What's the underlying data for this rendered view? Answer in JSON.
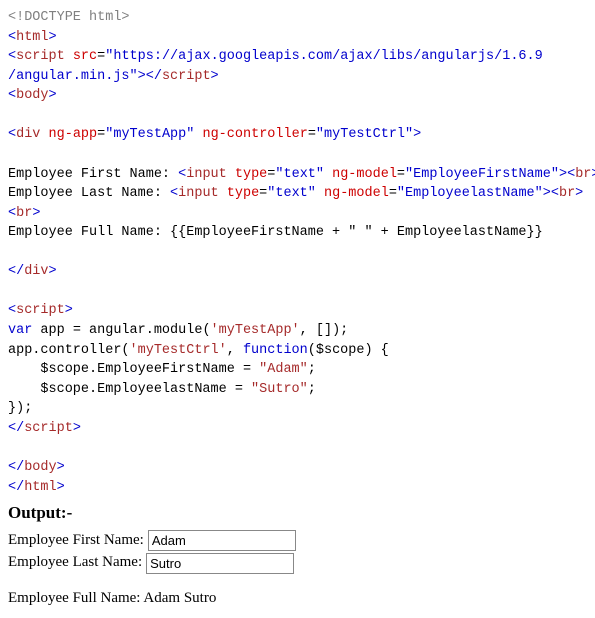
{
  "code": {
    "doctype": "<!DOCTYPE html>",
    "html_open_lt": "<",
    "html_open_name": "html",
    "html_open_gt": ">",
    "script_open_lt": "<",
    "script_name": "script",
    "src_attr": "src",
    "eq": "=",
    "src_val_q": "\"https://ajax.googleapis.com/ajax/libs/angularjs/1.6.9",
    "src_val2_q": "/angular.min.js\"",
    "script_open_gt": ">",
    "script_close": "</",
    "script_close_gt": ">",
    "body_open_lt": "<",
    "body_name": "body",
    "body_open_gt": ">",
    "div_open_lt": "<",
    "div_name": "div",
    "ngapp_attr": "ng-app",
    "ngapp_val": "\"myTestApp\"",
    "ngctrl_attr": "ng-controller",
    "ngctrl_val": "\"myTestCtrl\"",
    "div_open_gt": ">",
    "efn_label": "Employee First Name: ",
    "input_lt": "<",
    "input_name": "input",
    "type_attr": "type",
    "type_val": "\"text\"",
    "ngmodel_attr": "ng-model",
    "ngmodel_val1": "\"EmployeeFirstName\"",
    "input_gt": ">",
    "br_lt": "<",
    "br_name": "br",
    "br_gt": ">",
    "eln_label": "Employee Last Name: ",
    "ngmodel_val2": "\"EmployeelastName\"",
    "efull_line": "Employee Full Name: {{EmployeeFirstName + \" \" + EmployeelastName}}",
    "div_close_lt": "</",
    "div_close_gt": ">",
    "script2_open_lt": "<",
    "script2_open_gt": ">",
    "js_var": "var",
    "js_line1_rest": " app = angular.module(",
    "js_str1": "'myTestApp'",
    "js_line1_end": ", []);",
    "js_line2_a": "app.controller(",
    "js_str2": "'myTestCtrl'",
    "js_line2_b": ", ",
    "js_func": "function",
    "js_line2_c": "($scope) {",
    "js_line3_a": "    $scope.EmployeeFirstName = ",
    "js_str3": "\"Adam\"",
    "js_semi": ";",
    "js_line4_a": "    $scope.EmployeelastName = ",
    "js_str4": "\"Sutro\"",
    "js_line5": "});",
    "script2_close_lt": "</",
    "script2_close_gt": ">",
    "body_close_lt": "</",
    "body_close_gt": ">",
    "html_close_lt": "</",
    "html_close_gt": ">"
  },
  "output": {
    "heading": "Output:-",
    "first_label": "Employee First Name:",
    "last_label": "Employee Last Name:",
    "first_value": "Adam",
    "last_value": "Sutro",
    "full_label": "Employee Full Name: ",
    "full_value": "Adam Sutro"
  }
}
